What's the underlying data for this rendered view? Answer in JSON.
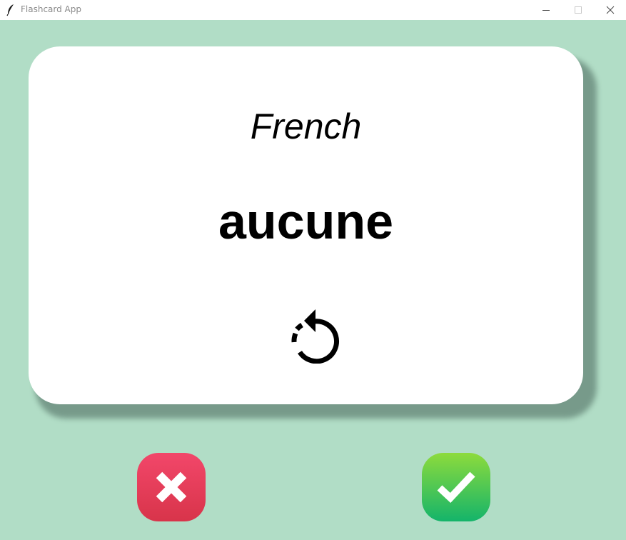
{
  "window": {
    "title": "Flashcard App",
    "icons": [
      "feather-icon",
      "minimize-icon",
      "maximize-icon",
      "close-icon"
    ]
  },
  "card": {
    "language": "French",
    "word": "aucune",
    "flip_icon": "refresh-icon"
  },
  "controls": {
    "wrong_icon": "x-icon",
    "right_icon": "checkmark-icon"
  },
  "colors": {
    "background": "#b1ddc6",
    "card": "#ffffff",
    "wrong": "#e23e58",
    "right": "#3fc55a"
  }
}
